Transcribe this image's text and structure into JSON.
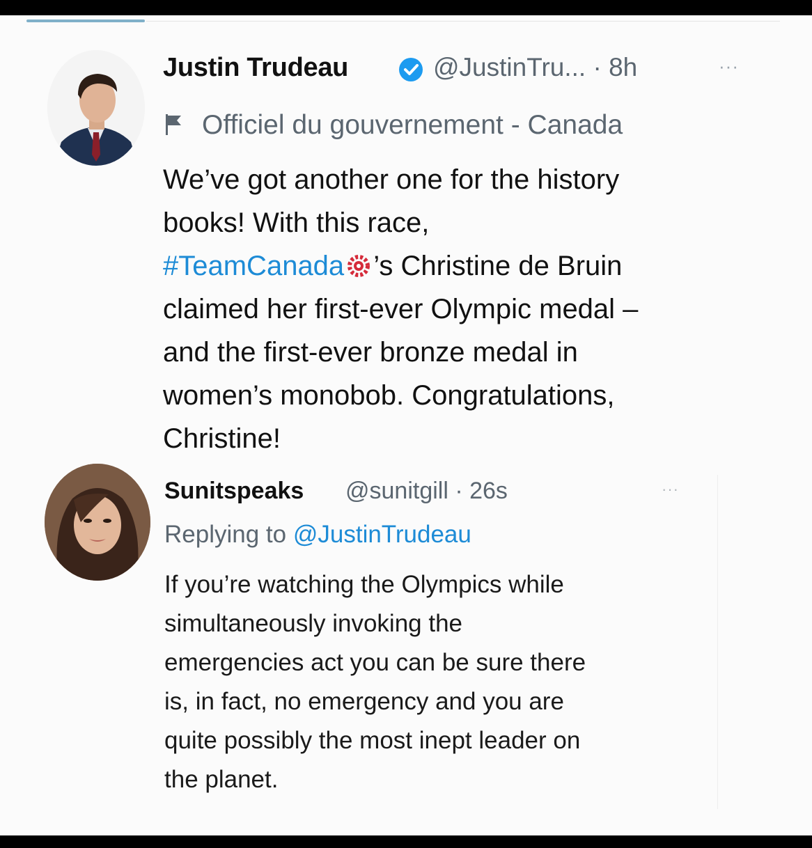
{
  "tweet": {
    "author_name": "Justin Trudeau",
    "handle_time": "@JustinTru... · 8h",
    "more_label": "···",
    "gov_label": "Officiel du gouvernement - Canada",
    "body_line1": "We’ve got another one for the history",
    "body_line2": "books! With this race,",
    "hashtag": "#TeamCanada",
    "after_hashtag": "’s Christine de Bruin",
    "body_line4": "claimed her first-ever Olympic medal –",
    "body_line5": "and the first-ever bronze medal in",
    "body_line6": "women’s monobob. Congratulations,",
    "body_line7": "Christine!"
  },
  "reply": {
    "author_name": "Sunitspeaks",
    "handle_time": "@sunitgill · 26s",
    "more_label": "···",
    "replying_prefix": "Replying to",
    "replying_to": "@JustinTrudeau",
    "body_line1": "If you’re watching the Olympics while",
    "body_line2": "simultaneously invoking the",
    "body_line3": "emergencies act you can be sure there",
    "body_line4": "is, in fact, no emergency and you are",
    "body_line5": "quite possibly the most inept leader on",
    "body_line6": "the planet."
  },
  "colors": {
    "link": "#1d8bd6",
    "verified": "#1d9bf0",
    "secondary_text": "#5b6670",
    "card_bg": "#fbfbfb"
  },
  "icons": {
    "verified": "verified-badge-icon",
    "gov": "government-flag-icon",
    "hashtag_emoji": "team-canada-emoji-icon"
  }
}
